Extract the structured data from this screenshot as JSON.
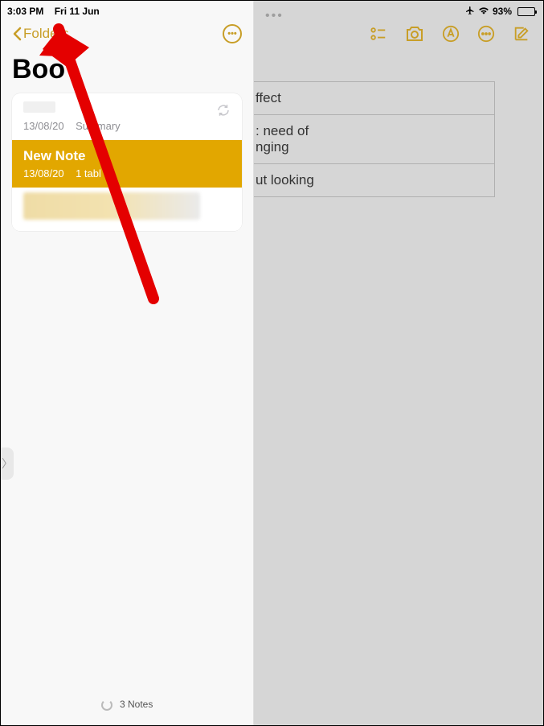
{
  "status": {
    "time": "3:03 PM",
    "date": "Fri 11 Jun",
    "battery": "93%"
  },
  "sidebar": {
    "back_label": "Folders",
    "title": "Boo",
    "notes": [
      {
        "title": "",
        "date": "13/08/20",
        "preview": "Summary",
        "sync": true
      },
      {
        "title": "New Note",
        "date": "13/08/20",
        "preview": "1 tabl",
        "selected": true
      }
    ],
    "footer": "3 Notes"
  },
  "detail": {
    "table_rows": [
      "ffect",
      ": need of\nnging",
      "ut looking"
    ]
  },
  "colors": {
    "tint": "#C89E27",
    "selection": "#E2A700"
  }
}
